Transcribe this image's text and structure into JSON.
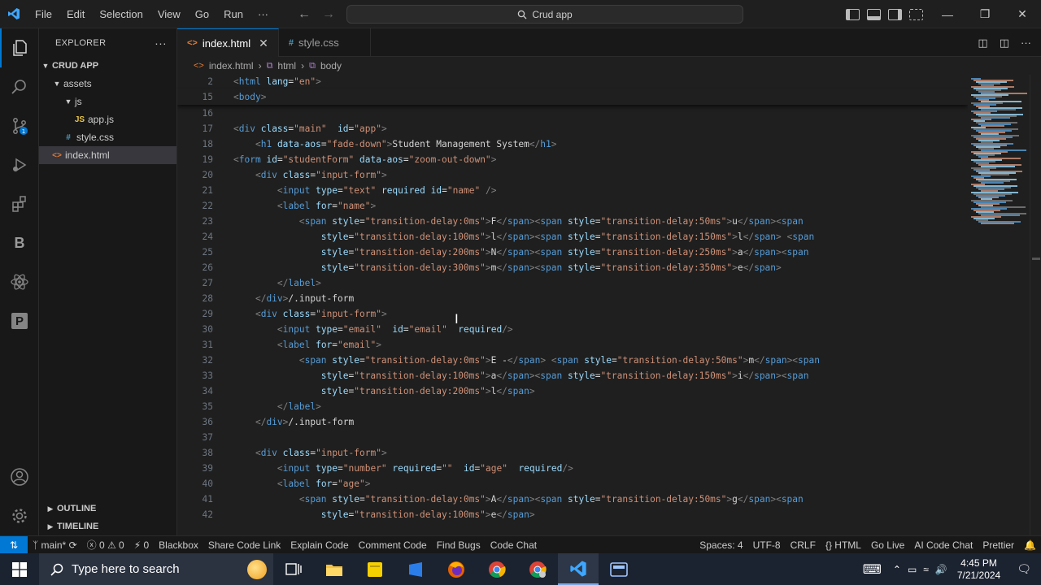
{
  "titlebar": {
    "menu": [
      "File",
      "Edit",
      "Selection",
      "View",
      "Go",
      "Run",
      "···"
    ],
    "search_text": "Crud app",
    "window_controls": [
      "—",
      "❐",
      "✕"
    ]
  },
  "explorer": {
    "title": "EXPLORER",
    "more": "···",
    "root": "CRUD APP",
    "tree": [
      {
        "label": "assets",
        "indent": 1,
        "type": "folder"
      },
      {
        "label": "js",
        "indent": 2,
        "type": "folder"
      },
      {
        "label": "app.js",
        "indent": 3,
        "type": "js",
        "icon": "JS"
      },
      {
        "label": "style.css",
        "indent": 2,
        "type": "css",
        "icon": "#"
      },
      {
        "label": "index.html",
        "indent": 1,
        "type": "html",
        "icon": "<>",
        "selected": true
      }
    ],
    "outline": "OUTLINE",
    "timeline": "TIMELINE"
  },
  "tabs": [
    {
      "label": "index.html",
      "icon": "<>",
      "active": true
    },
    {
      "label": "style.css",
      "icon": "#",
      "active": false
    }
  ],
  "breadcrumb": [
    "index.html",
    "html",
    "body"
  ],
  "editor": {
    "lines": [
      {
        "n": "2",
        "sticky": true,
        "h": "<span class='p'>&lt;</span><span class='t'>html</span> <span class='a'>lang</span>=<span class='s'>\"en\"</span><span class='p'>&gt;</span>"
      },
      {
        "n": "15",
        "sticky": true,
        "h": "<span class='p'>&lt;</span><span class='t'>body</span><span class='p'>&gt;</span>"
      },
      {
        "n": "16",
        "h": ""
      },
      {
        "n": "17",
        "h": "<span class='p'>&lt;</span><span class='t'>div</span> <span class='a'>class</span>=<span class='s'>\"main\"</span>  <span class='a'>id</span>=<span class='s'>\"app\"</span><span class='p'>&gt;</span>"
      },
      {
        "n": "18",
        "h": "    <span class='p'>&lt;</span><span class='t'>h1</span> <span class='a'>data-aos</span>=<span class='s'>\"fade-down\"</span><span class='p'>&gt;</span>Student Management System<span class='p'>&lt;/</span><span class='t'>h1</span><span class='p'>&gt;</span>"
      },
      {
        "n": "19",
        "h": "<span class='p'>&lt;</span><span class='t'>form</span> <span class='a'>id</span>=<span class='s'>\"studentForm\"</span> <span class='a'>data-aos</span>=<span class='s'>\"zoom-out-down\"</span><span class='p'>&gt;</span>"
      },
      {
        "n": "20",
        "h": "    <span class='p'>&lt;</span><span class='t'>div</span> <span class='a'>class</span>=<span class='s'>\"input-form\"</span><span class='p'>&gt;</span>"
      },
      {
        "n": "21",
        "h": "        <span class='p'>&lt;</span><span class='t'>input</span> <span class='a'>type</span>=<span class='s'>\"text\"</span> <span class='a'>required</span> <span class='a'>id</span>=<span class='s'>\"name\"</span> <span class='p'>/&gt;</span>"
      },
      {
        "n": "22",
        "h": "        <span class='p'>&lt;</span><span class='t'>label</span> <span class='a'>for</span>=<span class='s'>\"name\"</span><span class='p'>&gt;</span>"
      },
      {
        "n": "23",
        "h": "            <span class='p'>&lt;</span><span class='t'>span</span> <span class='a'>style</span>=<span class='s'>\"transition-delay:0ms\"</span><span class='p'>&gt;</span>F<span class='p'>&lt;/</span><span class='t'>span</span><span class='p'>&gt;&lt;</span><span class='t'>span</span> <span class='a'>style</span>=<span class='s'>\"transition-delay:50ms\"</span><span class='p'>&gt;</span>u<span class='p'>&lt;/</span><span class='t'>span</span><span class='p'>&gt;&lt;</span><span class='t'>span</span>"
      },
      {
        "n": "24",
        "h": "                <span class='a'>style</span>=<span class='s'>\"transition-delay:100ms\"</span><span class='p'>&gt;</span>l<span class='p'>&lt;/</span><span class='t'>span</span><span class='p'>&gt;&lt;</span><span class='t'>span</span> <span class='a'>style</span>=<span class='s'>\"transition-delay:150ms\"</span><span class='p'>&gt;</span>l<span class='p'>&lt;/</span><span class='t'>span</span><span class='p'>&gt;</span> <span class='p'>&lt;</span><span class='t'>span</span>"
      },
      {
        "n": "25",
        "h": "                <span class='a'>style</span>=<span class='s'>\"transition-delay:200ms\"</span><span class='p'>&gt;</span>N<span class='p'>&lt;/</span><span class='t'>span</span><span class='p'>&gt;&lt;</span><span class='t'>span</span> <span class='a'>style</span>=<span class='s'>\"transition-delay:250ms\"</span><span class='p'>&gt;</span>a<span class='p'>&lt;/</span><span class='t'>span</span><span class='p'>&gt;&lt;</span><span class='t'>span</span>"
      },
      {
        "n": "26",
        "h": "                <span class='a'>style</span>=<span class='s'>\"transition-delay:300ms\"</span><span class='p'>&gt;</span>m<span class='p'>&lt;/</span><span class='t'>span</span><span class='p'>&gt;&lt;</span><span class='t'>span</span> <span class='a'>style</span>=<span class='s'>\"transition-delay:350ms\"</span><span class='p'>&gt;</span>e<span class='p'>&lt;/</span><span class='t'>span</span><span class='p'>&gt;</span>"
      },
      {
        "n": "27",
        "h": "        <span class='p'>&lt;/</span><span class='t'>label</span><span class='p'>&gt;</span>"
      },
      {
        "n": "28",
        "h": "    <span class='p'>&lt;/</span><span class='t'>div</span><span class='p'>&gt;</span>/.input-form"
      },
      {
        "n": "29",
        "h": "    <span class='p'>&lt;</span><span class='t'>div</span> <span class='a'>class</span>=<span class='s'>\"input-form\"</span><span class='p'>&gt;</span>"
      },
      {
        "n": "30",
        "h": "        <span class='p'>&lt;</span><span class='t'>input</span> <span class='a'>type</span>=<span class='s'>\"email\"</span>  <span class='a'>id</span>=<span class='s'>\"email\"</span>  <span class='a'>required</span><span class='p'>/&gt;</span>"
      },
      {
        "n": "31",
        "h": "        <span class='p'>&lt;</span><span class='t'>label</span> <span class='a'>for</span>=<span class='s'>\"email\"</span><span class='p'>&gt;</span>"
      },
      {
        "n": "32",
        "h": "            <span class='p'>&lt;</span><span class='t'>span</span> <span class='a'>style</span>=<span class='s'>\"transition-delay:0ms\"</span><span class='p'>&gt;</span>E -<span class='p'>&lt;/</span><span class='t'>span</span><span class='p'>&gt;</span> <span class='p'>&lt;</span><span class='t'>span</span> <span class='a'>style</span>=<span class='s'>\"transition-delay:50ms\"</span><span class='p'>&gt;</span>m<span class='p'>&lt;/</span><span class='t'>span</span><span class='p'>&gt;&lt;</span><span class='t'>span</span>"
      },
      {
        "n": "33",
        "h": "                <span class='a'>style</span>=<span class='s'>\"transition-delay:100ms\"</span><span class='p'>&gt;</span>a<span class='p'>&lt;/</span><span class='t'>span</span><span class='p'>&gt;&lt;</span><span class='t'>span</span> <span class='a'>style</span>=<span class='s'>\"transition-delay:150ms\"</span><span class='p'>&gt;</span>i<span class='p'>&lt;/</span><span class='t'>span</span><span class='p'>&gt;&lt;</span><span class='t'>span</span>"
      },
      {
        "n": "34",
        "h": "                <span class='a'>style</span>=<span class='s'>\"transition-delay:200ms\"</span><span class='p'>&gt;</span>l<span class='p'>&lt;/</span><span class='t'>span</span><span class='p'>&gt;</span>"
      },
      {
        "n": "35",
        "h": "        <span class='p'>&lt;/</span><span class='t'>label</span><span class='p'>&gt;</span>"
      },
      {
        "n": "36",
        "h": "    <span class='p'>&lt;/</span><span class='t'>div</span><span class='p'>&gt;</span>/.input-form"
      },
      {
        "n": "37",
        "h": ""
      },
      {
        "n": "38",
        "h": "    <span class='p'>&lt;</span><span class='t'>div</span> <span class='a'>class</span>=<span class='s'>\"input-form\"</span><span class='p'>&gt;</span>"
      },
      {
        "n": "39",
        "h": "        <span class='p'>&lt;</span><span class='t'>input</span> <span class='a'>type</span>=<span class='s'>\"number\"</span> <span class='a'>required</span>=<span class='s'>\"\"</span>  <span class='a'>id</span>=<span class='s'>\"age\"</span>  <span class='a'>required</span><span class='p'>/&gt;</span>"
      },
      {
        "n": "40",
        "h": "        <span class='p'>&lt;</span><span class='t'>label</span> <span class='a'>for</span>=<span class='s'>\"age\"</span><span class='p'>&gt;</span>"
      },
      {
        "n": "41",
        "h": "            <span class='p'>&lt;</span><span class='t'>span</span> <span class='a'>style</span>=<span class='s'>\"transition-delay:0ms\"</span><span class='p'>&gt;</span>A<span class='p'>&lt;/</span><span class='t'>span</span><span class='p'>&gt;&lt;</span><span class='t'>span</span> <span class='a'>style</span>=<span class='s'>\"transition-delay:50ms\"</span><span class='p'>&gt;</span>g<span class='p'>&lt;/</span><span class='t'>span</span><span class='p'>&gt;&lt;</span><span class='t'>span</span>"
      },
      {
        "n": "42",
        "h": "                <span class='a'>style</span>=<span class='s'>\"transition-delay:100ms\"</span><span class='p'>&gt;</span>e<span class='p'>&lt;/</span><span class='t'>span</span><span class='p'>&gt;</span>"
      }
    ]
  },
  "statusbar": {
    "branch": "main*",
    "problems": "ⓧ 0 ⚠ 0",
    "ports": "⚡ 0",
    "left_items": [
      "Blackbox",
      "Share Code Link",
      "Explain Code",
      "Comment Code",
      "Find Bugs",
      "Code Chat"
    ],
    "right_items": [
      "Spaces: 4",
      "UTF-8",
      "CRLF",
      "{} HTML",
      "Go Live",
      "AI Code Chat",
      "Prettier"
    ]
  },
  "taskbar": {
    "search_placeholder": "Type here to search",
    "time": "4:45 PM",
    "date": "7/21/2024"
  },
  "colors": {
    "accent": "#0078d4",
    "editor_bg": "#1f1f1f",
    "sidebar_bg": "#181818"
  }
}
